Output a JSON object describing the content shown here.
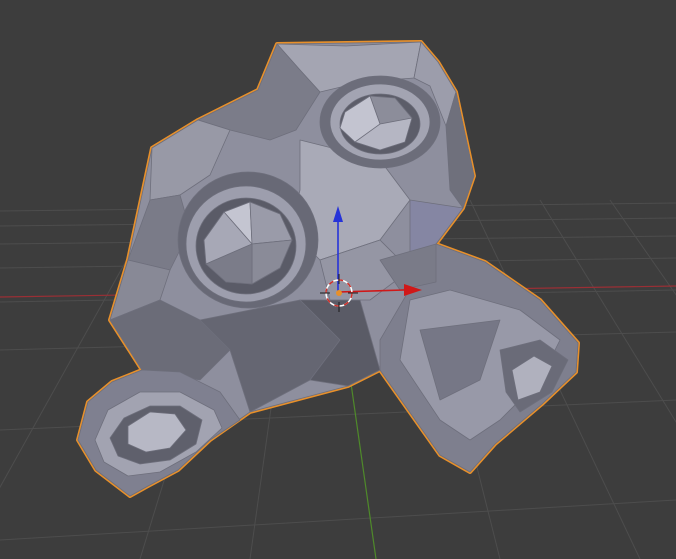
{
  "viewport": {
    "background": "#3d3d3d",
    "grid_color": "#4d4d4d",
    "x_axis_color": "#9a2f35",
    "y_axis_color": "#4f8a2a",
    "z_gizmo_color": "#2633d8",
    "x_gizmo_color": "#d01818",
    "mesh_base": "#8e8f9e",
    "mesh_shadow": "#5f606c",
    "mesh_highlight": "#b6b7c4",
    "selection_outline": "#e8902a"
  },
  "objects": [
    {
      "name": "suzanne-mesh",
      "type": "mesh",
      "selected": true
    }
  ],
  "cursor": {
    "name": "3d-cursor",
    "colors": [
      "#ffffff",
      "#d0302a"
    ]
  },
  "gizmo": {
    "name": "transform-gizmo",
    "axes": [
      "z",
      "x"
    ]
  }
}
